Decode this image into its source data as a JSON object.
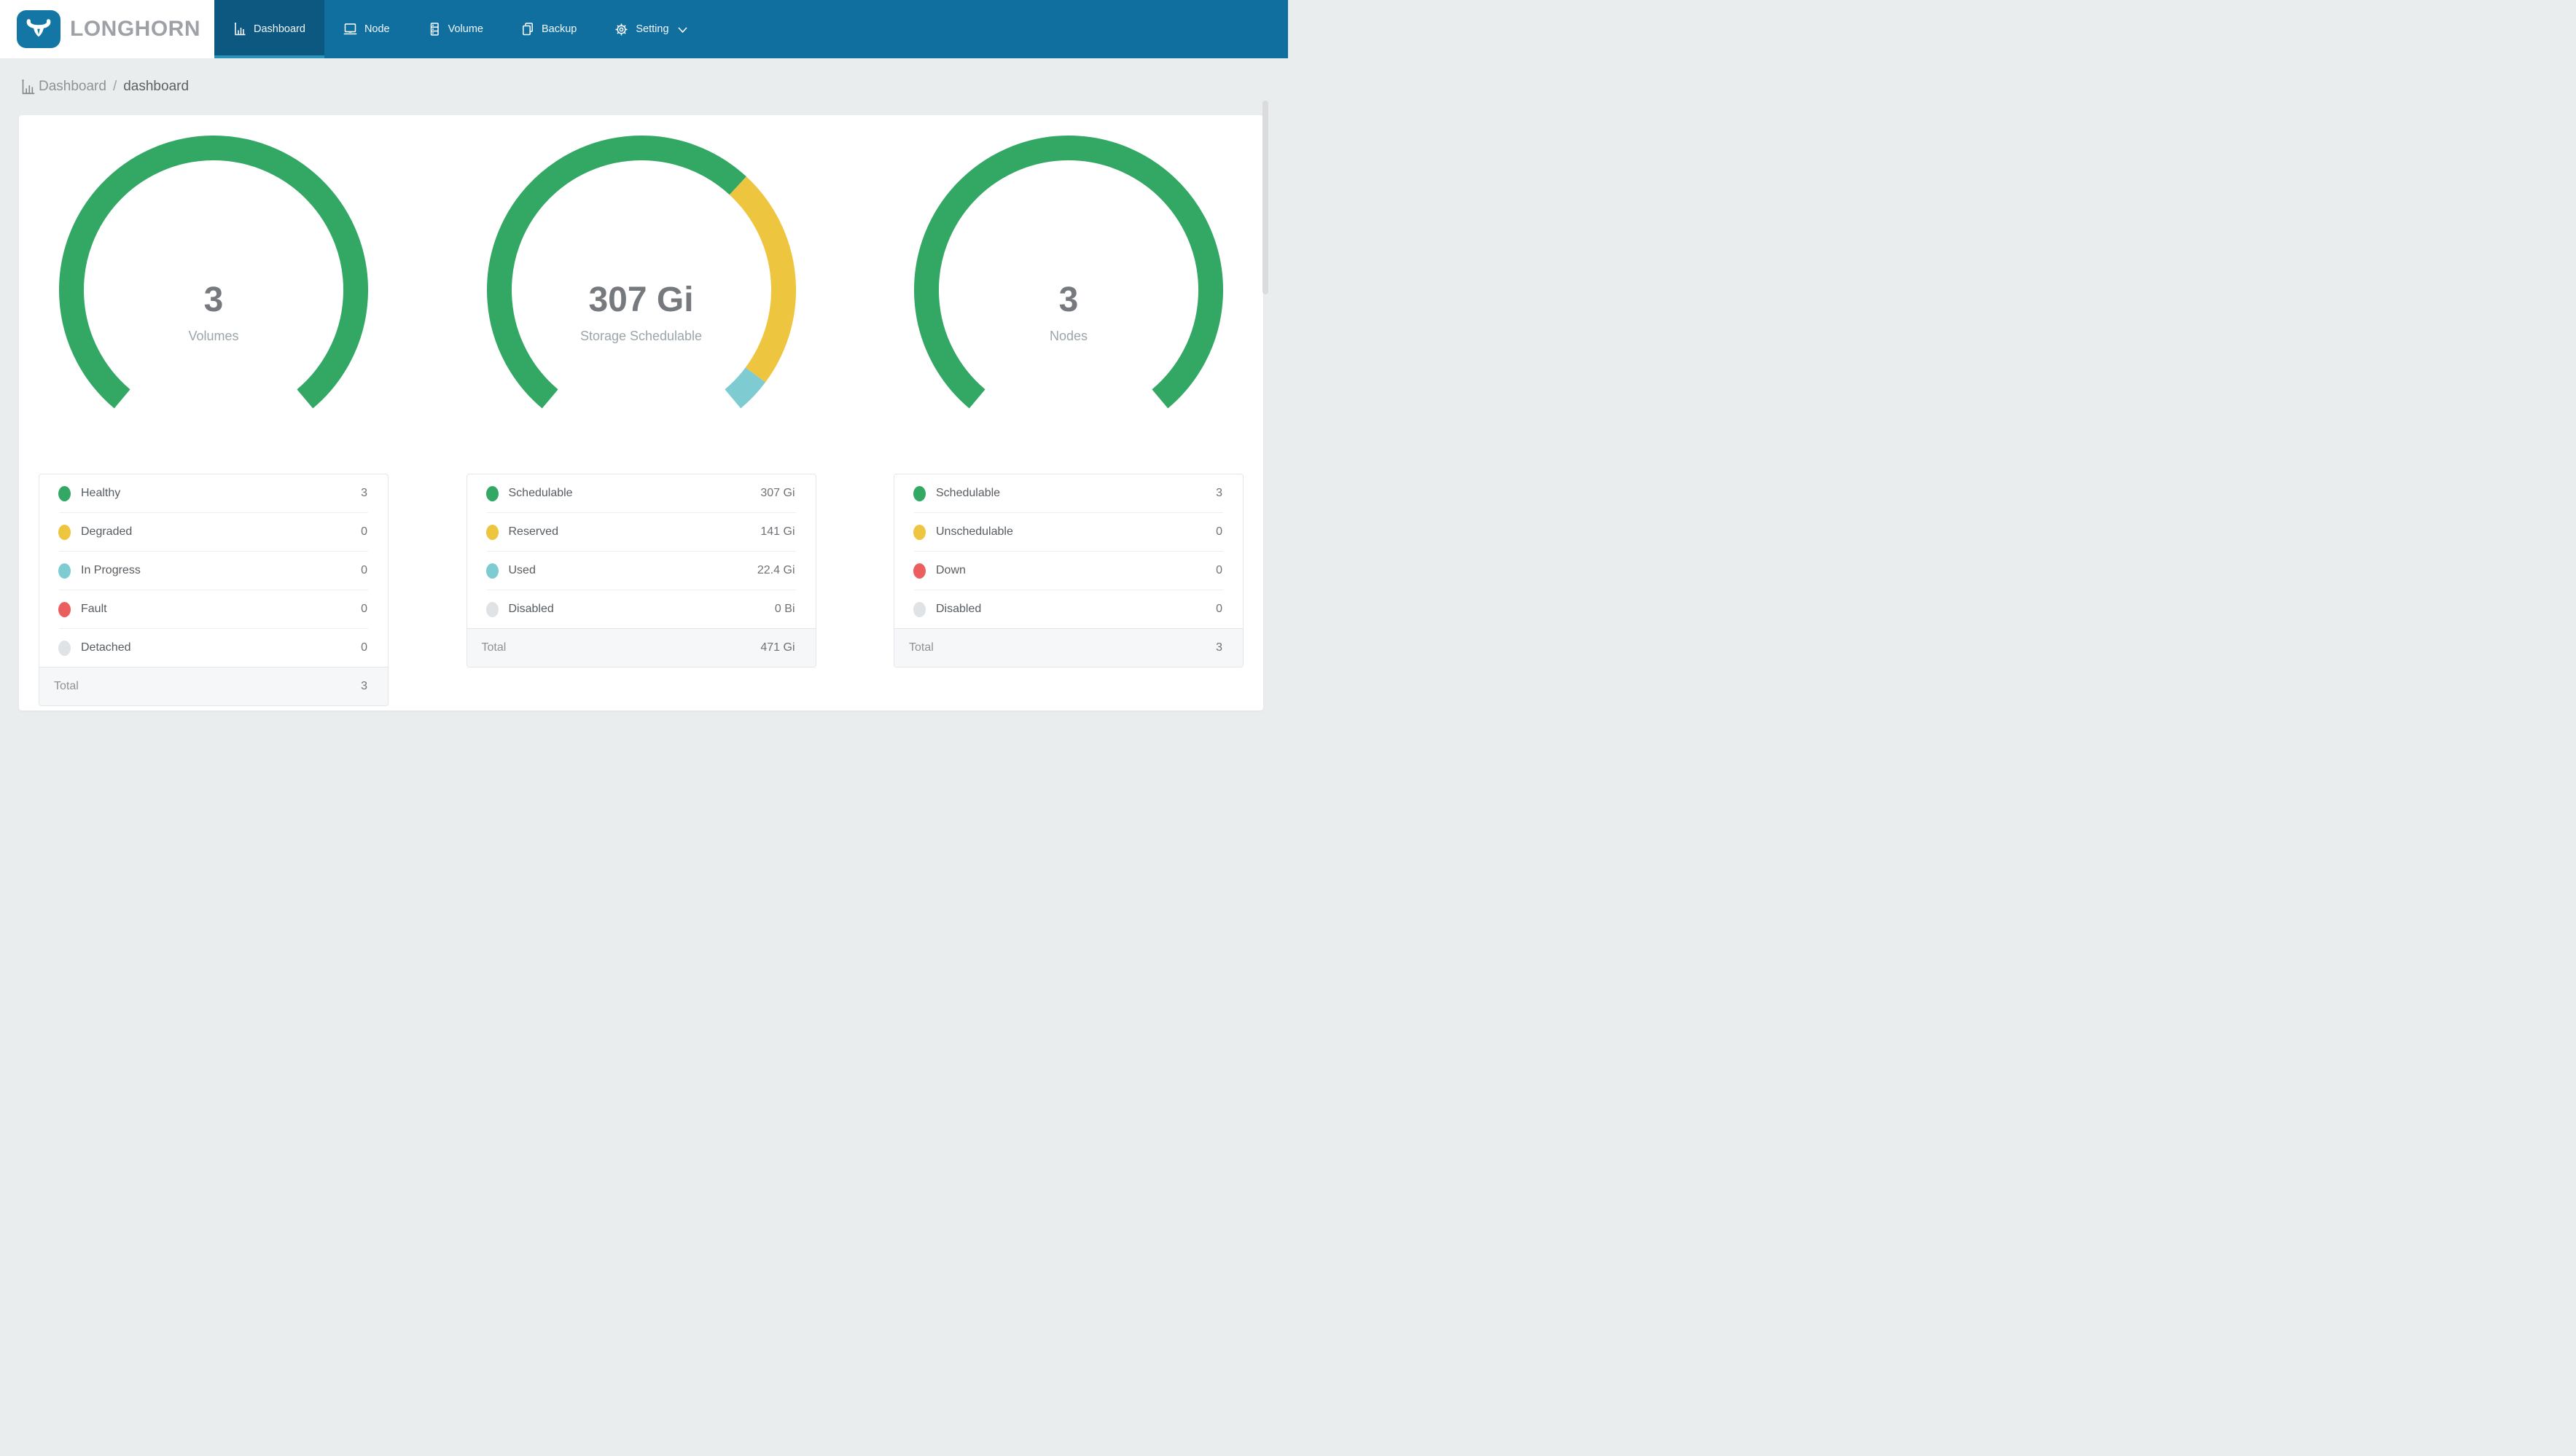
{
  "brand": {
    "name": "LONGHORN"
  },
  "navbar": {
    "items": [
      {
        "label": "Dashboard",
        "icon": "bar-chart-icon",
        "active": true
      },
      {
        "label": "Node",
        "icon": "node-icon",
        "active": false
      },
      {
        "label": "Volume",
        "icon": "volume-icon",
        "active": false
      },
      {
        "label": "Backup",
        "icon": "backup-icon",
        "active": false
      },
      {
        "label": "Setting",
        "icon": "gear-icon",
        "active": false,
        "has_dropdown": true
      }
    ]
  },
  "breadcrumb": {
    "icon": "bar-chart-icon",
    "section": "Dashboard",
    "separator": "/",
    "current": "dashboard"
  },
  "colors": {
    "navbar_bg": "#106F9F",
    "navbar_active_bg": "#0C5880",
    "navbar_active_underline": "#2B93B9",
    "logo_square": "#1476A4",
    "page_bg": "#E9EDEE",
    "green": "#32A864",
    "yellow": "#EDC53F",
    "teal": "#7ECBD1",
    "red": "#EB5E5E",
    "disabled_gray": "#E0E3E6"
  },
  "chart_data": [
    {
      "type": "gauge",
      "title": "Volumes",
      "center_value": "3",
      "center_label": "Volumes",
      "start_angle_from_top_deg": 220,
      "sweep_deg": 280,
      "ring_color_when_single": "#32A864",
      "segments": [
        {
          "label": "Healthy",
          "value": 3,
          "display": "3",
          "color": "#32A864"
        },
        {
          "label": "Degraded",
          "value": 0,
          "display": "0",
          "color": "#EDC53F"
        },
        {
          "label": "In Progress",
          "value": 0,
          "display": "0",
          "color": "#7ECBD1"
        },
        {
          "label": "Fault",
          "value": 0,
          "display": "0",
          "color": "#EB5E5E"
        },
        {
          "label": "Detached",
          "value": 0,
          "display": "0",
          "color": "#E0E3E6"
        }
      ],
      "total": {
        "label": "Total",
        "display": "3"
      }
    },
    {
      "type": "gauge",
      "title": "Storage Schedulable",
      "center_value": "307 Gi",
      "center_label": "Storage Schedulable",
      "start_angle_from_top_deg": 220,
      "sweep_deg": 280,
      "segments": [
        {
          "label": "Schedulable",
          "value": 307,
          "display": "307 Gi",
          "color": "#32A864"
        },
        {
          "label": "Reserved",
          "value": 141,
          "display": "141 Gi",
          "color": "#EDC53F"
        },
        {
          "label": "Used",
          "value": 22.4,
          "display": "22.4 Gi",
          "color": "#7ECBD1"
        },
        {
          "label": "Disabled",
          "value": 0,
          "display": "0 Bi",
          "color": "#E0E3E6"
        }
      ],
      "total": {
        "label": "Total",
        "display": "471 Gi"
      }
    },
    {
      "type": "gauge",
      "title": "Nodes",
      "center_value": "3",
      "center_label": "Nodes",
      "start_angle_from_top_deg": 220,
      "sweep_deg": 280,
      "segments": [
        {
          "label": "Schedulable",
          "value": 3,
          "display": "3",
          "color": "#32A864"
        },
        {
          "label": "Unschedulable",
          "value": 0,
          "display": "0",
          "color": "#EDC53F"
        },
        {
          "label": "Down",
          "value": 0,
          "display": "0",
          "color": "#EB5E5E"
        },
        {
          "label": "Disabled",
          "value": 0,
          "display": "0",
          "color": "#E0E3E6"
        }
      ],
      "total": {
        "label": "Total",
        "display": "3"
      }
    }
  ]
}
